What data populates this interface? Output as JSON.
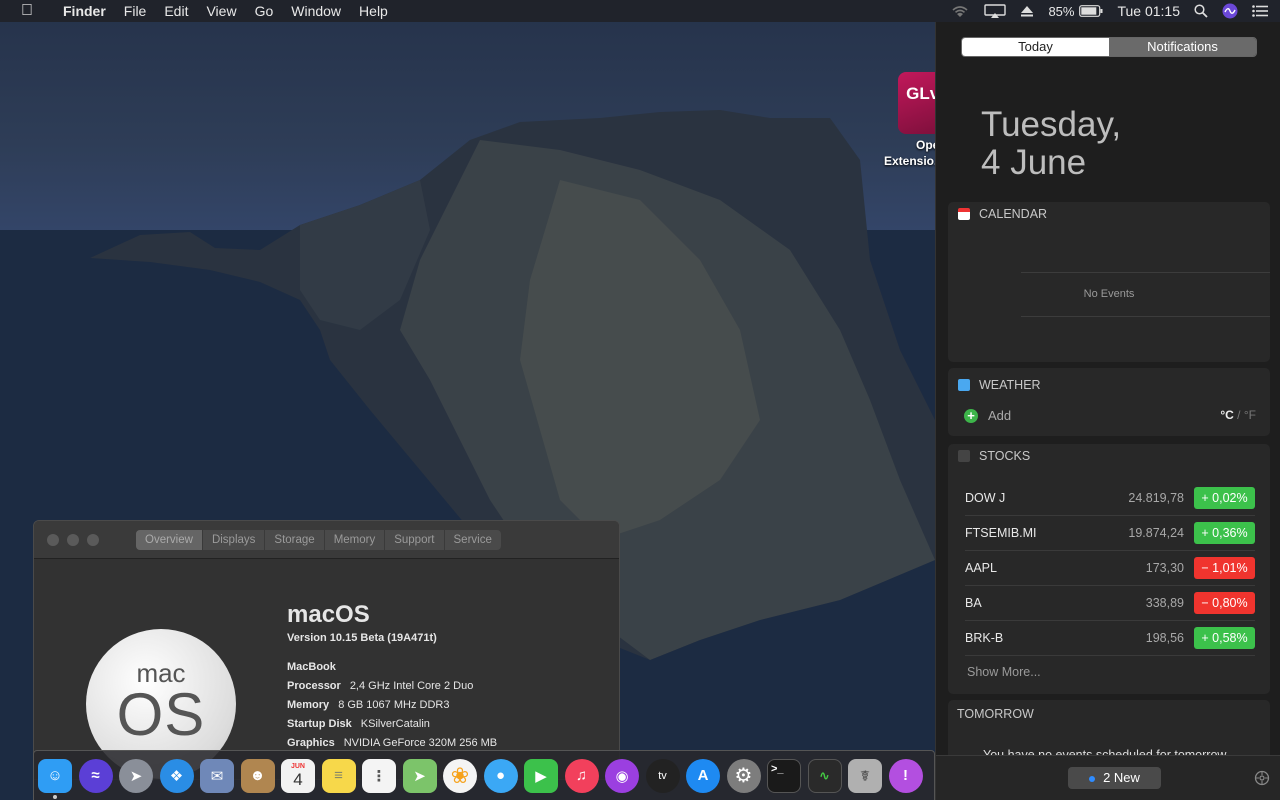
{
  "menubar": {
    "app_name": "Finder",
    "menus": [
      "File",
      "Edit",
      "View",
      "Go",
      "Window",
      "Help"
    ],
    "battery": "85%",
    "clock": "Tue 01:15"
  },
  "desktop_icon": {
    "logo_text": "GLvi",
    "label_line1": "Oper",
    "label_line2": "Extensio..."
  },
  "about_window": {
    "tabs": [
      "Overview",
      "Displays",
      "Storage",
      "Memory",
      "Support",
      "Service"
    ],
    "logo_mac": "mac",
    "logo_os": "OS",
    "os_name": "macOS",
    "version": "Version 10.15 Beta (19A471t)",
    "model": "MacBook",
    "specs": [
      {
        "label": "Processor",
        "value": "2,4 GHz Intel Core 2 Duo"
      },
      {
        "label": "Memory",
        "value": "8 GB 1067 MHz DDR3"
      },
      {
        "label": "Startup Disk",
        "value": "KSilverCatalin"
      },
      {
        "label": "Graphics",
        "value": "NVIDIA GeForce 320M 256 MB"
      }
    ]
  },
  "dock": {
    "apps": [
      {
        "name": "finder",
        "color": "#2f9df4"
      },
      {
        "name": "siri",
        "color": "#5b3fd6"
      },
      {
        "name": "launchpad",
        "color": "#8a8f99"
      },
      {
        "name": "safari",
        "color": "#2a8de5"
      },
      {
        "name": "mail",
        "color": "#6f88b8"
      },
      {
        "name": "contacts",
        "color": "#b08650"
      },
      {
        "name": "calendar",
        "color": "#f2f2f2"
      },
      {
        "name": "notes",
        "color": "#f7d84a"
      },
      {
        "name": "reminders",
        "color": "#f4f4f4"
      },
      {
        "name": "maps",
        "color": "#7cc46a"
      },
      {
        "name": "photos",
        "color": "#f4f4f4"
      },
      {
        "name": "messages",
        "color": "#3ba8f5"
      },
      {
        "name": "facetime",
        "color": "#3cc14b"
      },
      {
        "name": "music",
        "color": "#f2405c"
      },
      {
        "name": "podcasts",
        "color": "#9b3fe0"
      },
      {
        "name": "tv",
        "color": "#222222"
      },
      {
        "name": "app-store",
        "color": "#1e8af2"
      },
      {
        "name": "system-preferences",
        "color": "#7d7d7d"
      },
      {
        "name": "terminal",
        "color": "#1a1a1a"
      },
      {
        "name": "activity-monitor",
        "color": "#2a2a2a"
      },
      {
        "name": "disk-utility",
        "color": "#b0b0b0"
      },
      {
        "name": "feedback-assistant",
        "color": "#b34fe0"
      }
    ],
    "calendar_month": "JUN",
    "calendar_day": "4",
    "tv_label": "tv"
  },
  "notification_center": {
    "tabs": {
      "today": "Today",
      "notifications": "Notifications"
    },
    "date_line1": "Tuesday,",
    "date_line2": "4 June",
    "calendar": {
      "title": "CALENDAR",
      "empty": "No Events"
    },
    "weather": {
      "title": "WEATHER",
      "add": "Add",
      "unit_c": "°C",
      "sep": "/",
      "unit_f": "°F"
    },
    "stocks": {
      "title": "STOCKS",
      "rows": [
        {
          "symbol": "DOW J",
          "price": "24.819,78",
          "change": "+ 0,02%",
          "direction": "up"
        },
        {
          "symbol": "FTSEMIB.MI",
          "price": "19.874,24",
          "change": "+ 0,36%",
          "direction": "up"
        },
        {
          "symbol": "AAPL",
          "price": "173,30",
          "change": "− 1,01%",
          "direction": "down"
        },
        {
          "symbol": "BA",
          "price": "338,89",
          "change": "− 0,80%",
          "direction": "down"
        },
        {
          "symbol": "BRK-B",
          "price": "198,56",
          "change": "+ 0,58%",
          "direction": "up"
        }
      ],
      "show_more": "Show More..."
    },
    "tomorrow": {
      "title": "TOMORROW",
      "text": "You have no events scheduled for tomorrow."
    },
    "footer": {
      "new_label": "2 New"
    }
  }
}
